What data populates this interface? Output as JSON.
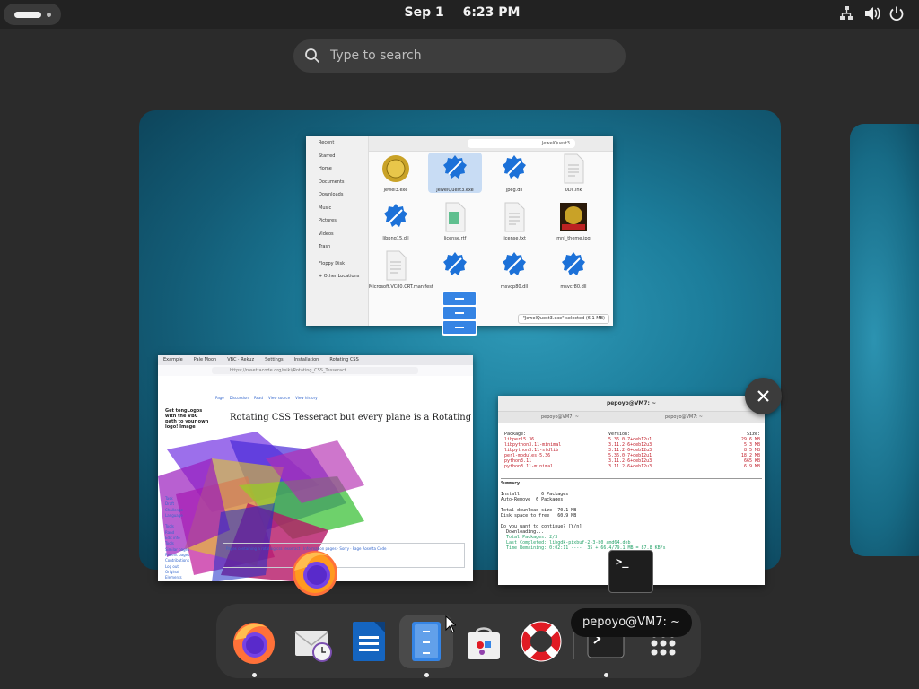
{
  "topbar": {
    "date": "Sep 1",
    "time": "6:23 PM"
  },
  "search": {
    "placeholder": "Type to search"
  },
  "files_window": {
    "sidebar": [
      "Recent",
      "Starred",
      "Home",
      "Documents",
      "Downloads",
      "Music",
      "Pictures",
      "Videos",
      "Trash",
      "Floppy Disk",
      "+ Other Locations"
    ],
    "path_label": "JewelQuest3",
    "items": [
      {
        "name": "jewel3.exe",
        "icon": "coin-icon"
      },
      {
        "name": "JewelQuest3.exe",
        "icon": "wine-gear-icon"
      },
      {
        "name": "jpeg.dll",
        "icon": "wine-gear-icon"
      },
      {
        "name": "0Dll.ink",
        "icon": "document-icon"
      },
      {
        "name": "libpng15.dll",
        "icon": "wine-gear-icon"
      },
      {
        "name": "license.rtf",
        "icon": "rtf-icon"
      },
      {
        "name": "license.txt",
        "icon": "document-icon"
      },
      {
        "name": "mnl_theme.jpg",
        "icon": "image-icon"
      },
      {
        "name": "Microsoft.VC80.CRT.manifest",
        "icon": "document-icon"
      },
      {
        "name": "",
        "icon": "wine-gear-icon"
      },
      {
        "name": "msvcp80.dll",
        "icon": "wine-gear-icon"
      },
      {
        "name": "msvcr80.dll",
        "icon": "wine-gear-icon"
      }
    ],
    "status": "\"JewelQuest3.exe\" selected (6.1 MB)"
  },
  "firefox_window": {
    "tabs": [
      "Example",
      "Pale Moon",
      "VBC · Rekuz",
      "Settings",
      "Installation",
      "Rotating CSS"
    ],
    "url": "https://rosettacode.org/wiki/Rotating_CSS_Tesseract",
    "page": {
      "left_note": "Get tongLogos with the VBC path to your own logo! Image",
      "tabs": [
        "Page",
        "Discussion",
        "Read",
        "View source",
        "View history"
      ],
      "title": "Rotating CSS Tesseract but every plane is a Rotating CSS Cube",
      "left_links": [
        "Task",
        "Draft",
        "Challenge",
        "Language",
        "",
        "Tools",
        "Rand",
        "Edit info",
        "Tools",
        "Similar pages",
        "Recent pages",
        "Contributions",
        "Log out",
        "Original",
        "Elements"
      ],
      "box_text": "Pages containing a rotating css tesseract · Information pages · Sorry · Page Rosetta Code"
    }
  },
  "terminal_window": {
    "title": "pepoyo@VM7: ~",
    "tab1": "pepoyo@VM7: ~",
    "tab2": "pepoyo@VM7: ~",
    "header": [
      "Package:",
      "Version:",
      "Size:"
    ],
    "packages": [
      {
        "name": "libperl5.36",
        "version": "5.36.0-7+deb12u1",
        "size": "29.6 MB"
      },
      {
        "name": "libpython3.11-minimal",
        "version": "3.11.2-6+deb12u3",
        "size": "5.3 MB"
      },
      {
        "name": "libpython3.11-stdlib",
        "version": "3.11.2-6+deb12u3",
        "size": "8.5 MB"
      },
      {
        "name": "perl-modules-5.36",
        "version": "5.36.0-7+deb12u1",
        "size": "18.2 MB"
      },
      {
        "name": "python3.11",
        "version": "3.11.2-6+deb12u3",
        "size": "665 KB"
      },
      {
        "name": "python3.11-minimal",
        "version": "3.11.2-6+deb12u3",
        "size": "6.9 MB"
      }
    ],
    "summary": [
      "Summary",
      "",
      "Install        6 Packages",
      "Auto-Remove  6 Packages",
      "",
      "Total download size  70.1 MB",
      "Disk space to free   60.9 MB",
      "",
      "Do you want to continue? [Y/n]",
      "  Downloading..."
    ],
    "progress": [
      "  Total Packages: 2/3",
      "  Last Completed: libgdk-pixbuf-2-3-b0 amd64.deb",
      "  Time Remaining: 0:02:11 ----  35 + 66.4/79.1 MB = 87.8 KB/s"
    ]
  },
  "tooltip": "pepoyo@VM7: ~",
  "terminal_badge": ">_",
  "dock": [
    {
      "name": "firefox",
      "icon": "firefox-icon",
      "running": true
    },
    {
      "name": "evolution",
      "icon": "mail-clock-icon",
      "running": false
    },
    {
      "name": "writer",
      "icon": "document-writer-icon",
      "running": false
    },
    {
      "name": "files",
      "icon": "file-cabinet-icon",
      "running": true,
      "active": true
    },
    {
      "name": "software",
      "icon": "software-bag-icon",
      "running": false
    },
    {
      "name": "help",
      "icon": "lifebuoy-icon",
      "running": false
    },
    {
      "name": "terminal",
      "icon": "terminal-icon",
      "running": true
    },
    {
      "name": "app-grid",
      "icon": "app-grid-icon",
      "running": false
    }
  ]
}
